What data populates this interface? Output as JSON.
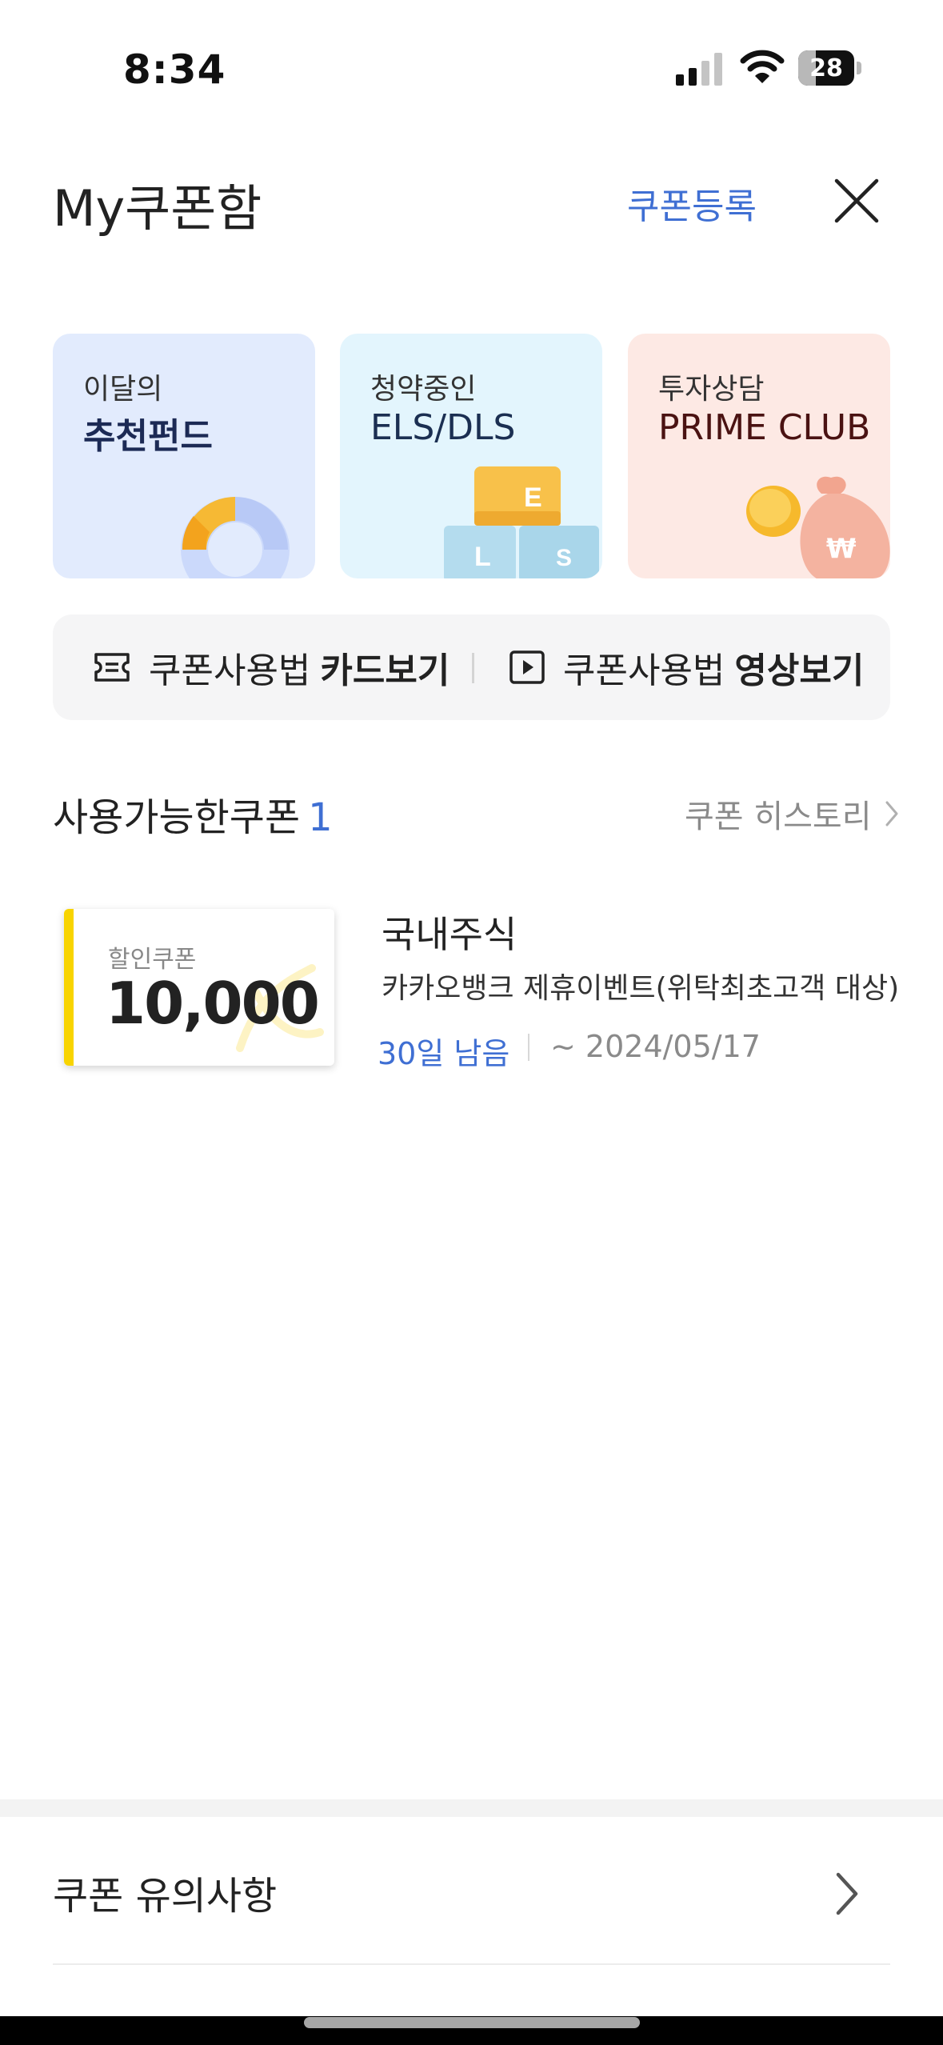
{
  "status_bar": {
    "time": "8:34",
    "battery_level": "28"
  },
  "header": {
    "title": "My쿠폰함",
    "register_label": "쿠폰등록"
  },
  "promo_cards": [
    {
      "line1": "이달의",
      "line2": "추천펀드"
    },
    {
      "line1": "청약중인",
      "line2": "ELS/DLS"
    },
    {
      "line1": "투자상담",
      "line2": "PRIME CLUB"
    }
  ],
  "guide": {
    "card_prefix": "쿠폰사용법",
    "card_bold": "카드보기",
    "video_prefix": "쿠폰사용법",
    "video_bold": "영상보기"
  },
  "section": {
    "title": "사용가능한쿠폰",
    "count": "1",
    "history_label": "쿠폰 히스토리"
  },
  "coupon": {
    "type": "할인쿠폰",
    "amount": "10,000",
    "name": "국내주식",
    "description": "카카오뱅크 제휴이벤트(위탁최초고객 대상)",
    "days_left": "30일 남음",
    "expiry": "~ 2024/05/17"
  },
  "notice": {
    "label": "쿠폰 유의사항"
  },
  "colors": {
    "accent": "#3f6fd3",
    "coupon_stripe": "#f8d400"
  }
}
